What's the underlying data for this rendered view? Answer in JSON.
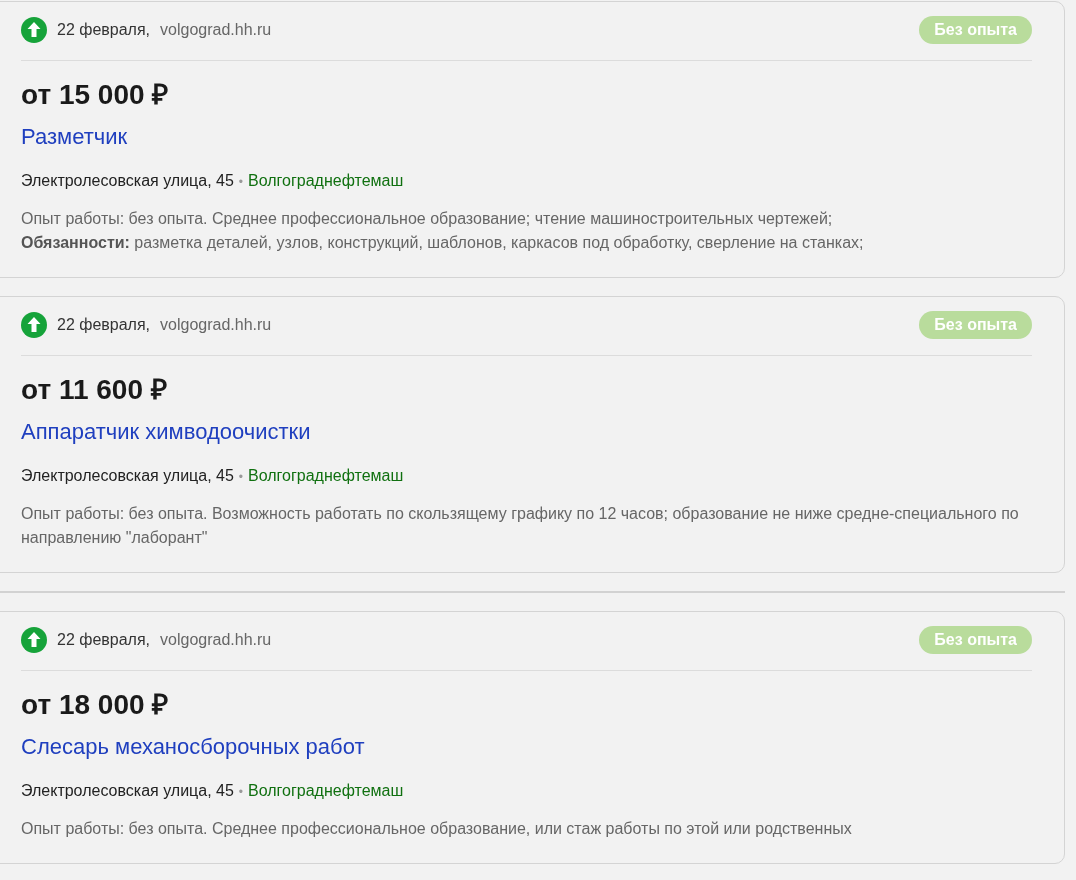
{
  "listing": [
    {
      "kind": "vacancy",
      "date": "22 февраля,",
      "source": "volgograd.hh.ru",
      "badge": "Без опыта",
      "salary": "от 15 000 ₽",
      "title": "Разметчик",
      "address": "Электролесовская улица, 45",
      "bullet": "•",
      "company": "Волгограднефтемаш",
      "description": [
        "Опыт работы: без опыта. Среднее профессиональное образование; чтение машиностроительных чертежей;",
        "**Обязанности:** разметка деталей, узлов, конструкций, шаблонов, каркасов под обработку, сверление на станках;"
      ]
    },
    {
      "kind": "vacancy",
      "date": "22 февраля,",
      "source": "volgograd.hh.ru",
      "badge": "Без опыта",
      "salary": "от 11 600 ₽",
      "title": "Аппаратчик химводоочистки",
      "address": "Электролесовская улица, 45",
      "bullet": "•",
      "company": "Волгограднефтемаш",
      "description": [
        "Опыт работы: без опыта. Возможность работать по скользящему графику по 12 часов; образование не ниже средне-специального по направлению \"лаборант\""
      ]
    },
    {
      "kind": "divider"
    },
    {
      "kind": "vacancy",
      "date": "22 февраля,",
      "source": "volgograd.hh.ru",
      "badge": "Без опыта",
      "salary": "от 18 000 ₽",
      "title": "Слесарь механосборочных работ",
      "address": "Электролесовская улица, 45",
      "bullet": "•",
      "company": "Волгограднефтемаш",
      "description": [
        "Опыт работы: без опыта. Среднее профессиональное образование, или стаж работы по этой или родственных"
      ]
    }
  ]
}
